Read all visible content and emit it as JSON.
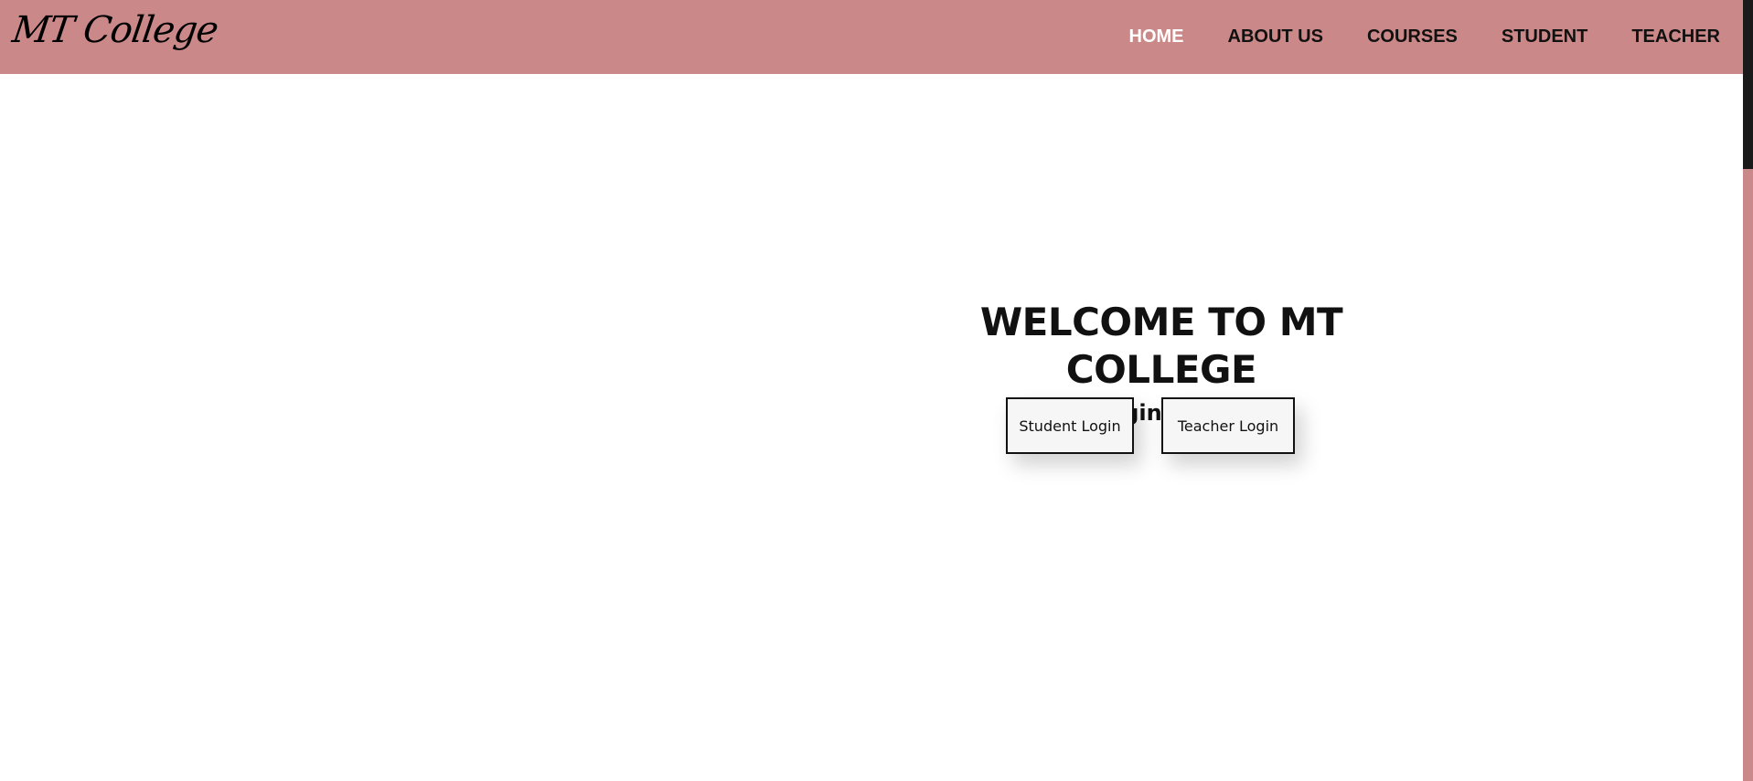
{
  "brand": {
    "logo_text": "MT College"
  },
  "nav": {
    "items": [
      {
        "label": "HOME",
        "active": true
      },
      {
        "label": "ABOUT US",
        "active": false
      },
      {
        "label": "COURSES",
        "active": false
      },
      {
        "label": "STUDENT",
        "active": false
      },
      {
        "label": "TEACHER",
        "active": false
      }
    ]
  },
  "hero": {
    "title": "WELCOME TO MT COLLEGE",
    "subtitle": "Login Here"
  },
  "actions": {
    "student_login": "Student Login",
    "teacher_login": "Teacher Login"
  },
  "colors": {
    "navbar_bg": "#cb8888",
    "active_nav": "#ffffff",
    "text": "#111111",
    "scroll_thumb": "#1a1a1a"
  }
}
